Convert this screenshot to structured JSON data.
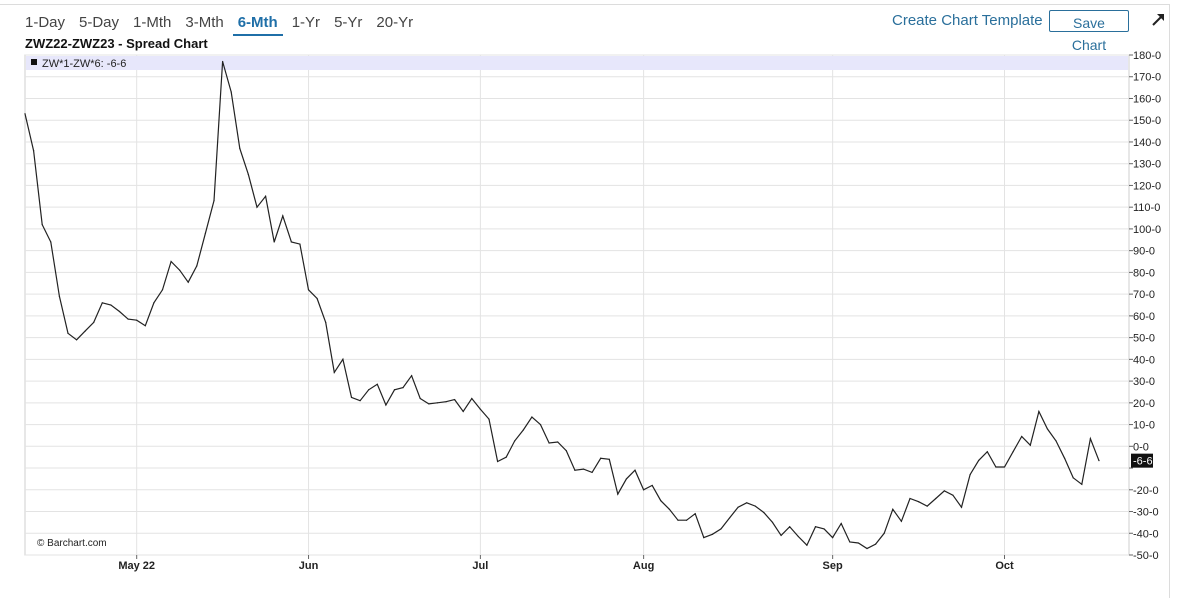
{
  "toolbar": {
    "ranges": [
      "1-Day",
      "5-Day",
      "1-Mth",
      "3-Mth",
      "6-Mth",
      "1-Yr",
      "5-Yr",
      "20-Yr"
    ],
    "active_range": "6-Mth",
    "create_template_label": "Create Chart Template",
    "save_label": "Save Chart",
    "expand_icon": "expand-arrow-icon"
  },
  "chart_data": {
    "type": "line",
    "title": "ZWZ22-ZWZ23 - Spread Chart",
    "legend": "ZW*1-ZW*6: -6-6",
    "current_value_label": "-6-6",
    "watermark": "© Barchart.com",
    "ylim": [
      -50,
      180
    ],
    "y_ticks": [
      180,
      170,
      160,
      150,
      140,
      130,
      120,
      110,
      100,
      90,
      80,
      70,
      60,
      50,
      40,
      30,
      20,
      10,
      0,
      -10,
      -20,
      -30,
      -40,
      -50
    ],
    "y_tick_labels": [
      "180-0",
      "170-0",
      "160-0",
      "150-0",
      "140-0",
      "130-0",
      "120-0",
      "110-0",
      "100-0",
      "90-0",
      "80-0",
      "70-0",
      "60-0",
      "50-0",
      "40-0",
      "30-0",
      "20-0",
      "10-0",
      "0-0",
      "",
      "-20-0",
      "-30-0",
      "-40-0",
      "-50-0"
    ],
    "x_ticks": [
      {
        "label": "May 22",
        "index": 13
      },
      {
        "label": "Jun",
        "index": 33
      },
      {
        "label": "Jul",
        "index": 53
      },
      {
        "label": "Aug",
        "index": 72
      },
      {
        "label": "Sep",
        "index": 94
      },
      {
        "label": "Oct",
        "index": 114
      }
    ],
    "grid": true,
    "series": [
      {
        "values": [
          153,
          136,
          102,
          94,
          69,
          52,
          49,
          53,
          57,
          66,
          65,
          62,
          58.5,
          58,
          55.5,
          66,
          72,
          85,
          81,
          75.5,
          83,
          98,
          113,
          177,
          163,
          137,
          125,
          110,
          115,
          94,
          106,
          94,
          93,
          72,
          68,
          57,
          34,
          40,
          22.5,
          21,
          26,
          28.5,
          19,
          26,
          27,
          32.5,
          22,
          19.5,
          20,
          20.5,
          21.5,
          16,
          22,
          17,
          12.5,
          -7,
          -5,
          2.5,
          7.5,
          13.5,
          10,
          1.5,
          2,
          -2,
          -11,
          -10.5,
          -12,
          -5.5,
          -6,
          -22,
          -15,
          -11,
          -20,
          -18,
          -25,
          -29,
          -34,
          -34,
          -31,
          -42,
          -40.5,
          -38,
          -33,
          -28,
          -26,
          -27.5,
          -30.5,
          -35,
          -41,
          -37,
          -41.5,
          -45.5,
          -37,
          -38,
          -42,
          -35.5,
          -44,
          -44.5,
          -47,
          -45,
          -40,
          -29,
          -34.5,
          -24,
          -25.5,
          -27.5,
          -24,
          -20.5,
          -22.5,
          -28,
          -13,
          -6.5,
          -2.5,
          -9.5,
          -9.5,
          -2.5,
          4.5,
          0.5,
          16,
          8,
          2.5,
          -5.5,
          -14.5,
          -17.5,
          3.5,
          -6.6
        ]
      }
    ]
  }
}
